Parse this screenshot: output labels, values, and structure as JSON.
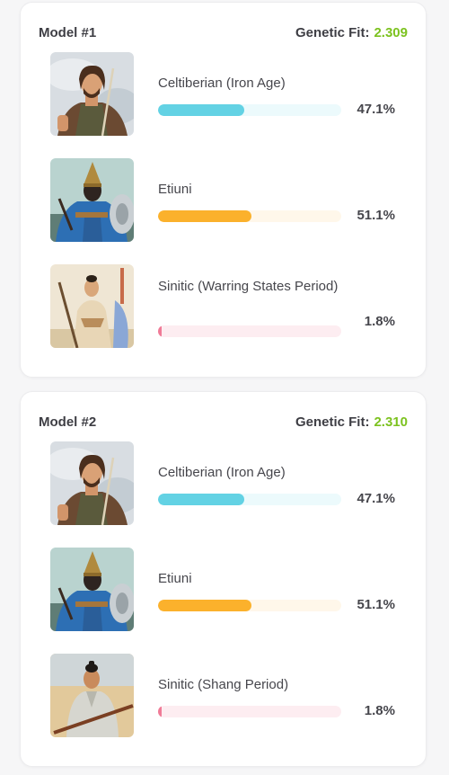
{
  "models": [
    {
      "title": "Model #1",
      "fit_label": "Genetic Fit:",
      "fit_value": "2.309",
      "populations": [
        {
          "name": "Celtiberian (Iron Age)",
          "percent_label": "47.1%",
          "percent": 47.1,
          "bar_color": "#63d2e4",
          "track_color": "#ecfafc",
          "icon": "celtiberian-warrior-portrait-icon"
        },
        {
          "name": "Etiuni",
          "percent_label": "51.1%",
          "percent": 51.1,
          "bar_color": "#fbb12c",
          "track_color": "#fff7ea",
          "icon": "etiuni-warrior-portrait-icon"
        },
        {
          "name": "Sinitic (Warring States Period)",
          "percent_label": "1.8%",
          "percent": 1.8,
          "bar_color": "#f07b97",
          "track_color": "#fdedf1",
          "icon": "warring-states-warrior-portrait-icon"
        }
      ]
    },
    {
      "title": "Model #2",
      "fit_label": "Genetic Fit:",
      "fit_value": "2.310",
      "populations": [
        {
          "name": "Celtiberian (Iron Age)",
          "percent_label": "47.1%",
          "percent": 47.1,
          "bar_color": "#63d2e4",
          "track_color": "#ecfafc",
          "icon": "celtiberian-warrior-portrait-icon"
        },
        {
          "name": "Etiuni",
          "percent_label": "51.1%",
          "percent": 51.1,
          "bar_color": "#fbb12c",
          "track_color": "#fff7ea",
          "icon": "etiuni-warrior-portrait-icon"
        },
        {
          "name": "Sinitic (Shang Period)",
          "percent_label": "1.8%",
          "percent": 1.8,
          "bar_color": "#f07b97",
          "track_color": "#fdedf1",
          "icon": "shang-warrior-portrait-icon"
        }
      ]
    }
  ],
  "colors": {
    "fit_value": "#7cc21f",
    "text": "#46464c",
    "background": "#f6f6f7",
    "card": "#ffffff"
  }
}
